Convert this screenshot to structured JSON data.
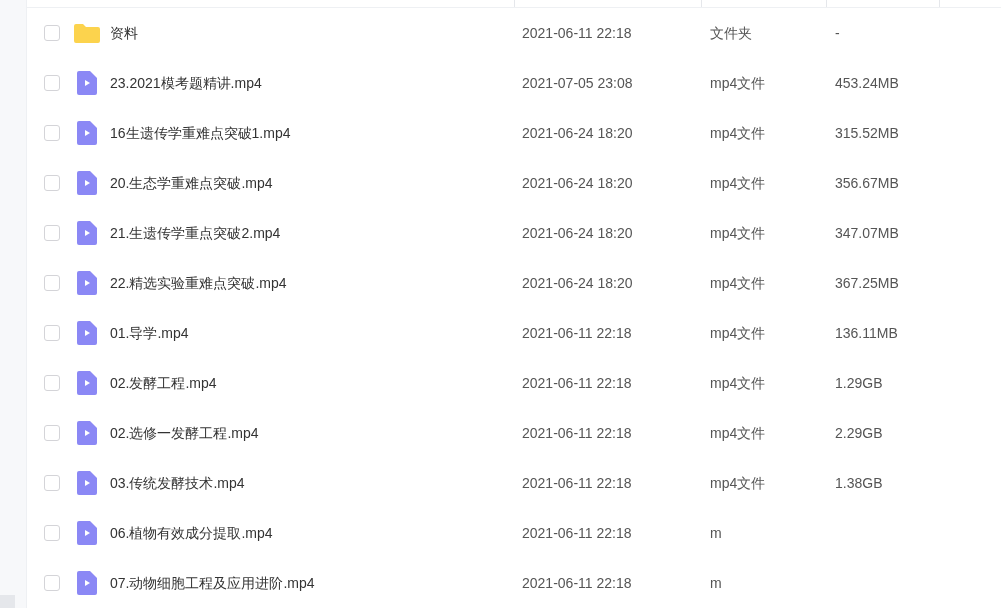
{
  "rows": [
    {
      "kind": "folder",
      "name": "资料",
      "date": "2021-06-11 22:18",
      "type": "文件夹",
      "size": "-",
      "checked": false
    },
    {
      "kind": "video",
      "name": "23.2021模考题精讲.mp4",
      "date": "2021-07-05 23:08",
      "type": "mp4文件",
      "size": "453.24MB",
      "checked": false
    },
    {
      "kind": "video",
      "name": "16生遗传学重难点突破1.mp4",
      "date": "2021-06-24 18:20",
      "type": "mp4文件",
      "size": "315.52MB",
      "checked": false
    },
    {
      "kind": "video",
      "name": "20.生态学重难点突破.mp4",
      "date": "2021-06-24 18:20",
      "type": "mp4文件",
      "size": "356.67MB",
      "checked": false
    },
    {
      "kind": "video",
      "name": "21.生遗传学重点突破2.mp4",
      "date": "2021-06-24 18:20",
      "type": "mp4文件",
      "size": "347.07MB",
      "checked": false
    },
    {
      "kind": "video",
      "name": "22.精选实验重难点突破.mp4",
      "date": "2021-06-24 18:20",
      "type": "mp4文件",
      "size": "367.25MB",
      "checked": false
    },
    {
      "kind": "video",
      "name": "01.导学.mp4",
      "date": "2021-06-11 22:18",
      "type": "mp4文件",
      "size": "136.11MB",
      "checked": false
    },
    {
      "kind": "video",
      "name": "02.发酵工程.mp4",
      "date": "2021-06-11 22:18",
      "type": "mp4文件",
      "size": "1.29GB",
      "checked": false
    },
    {
      "kind": "video",
      "name": "02.选修一发酵工程.mp4",
      "date": "2021-06-11 22:18",
      "type": "mp4文件",
      "size": "2.29GB",
      "checked": false
    },
    {
      "kind": "video",
      "name": "03.传统发酵技术.mp4",
      "date": "2021-06-11 22:18",
      "type": "mp4文件",
      "size": "1.38GB",
      "checked": false
    },
    {
      "kind": "video",
      "name": "06.植物有效成分提取.mp4",
      "date": "2021-06-11 22:18",
      "type": "m",
      "checked": false
    },
    {
      "kind": "video",
      "name": "07.动物细胞工程及应用进阶.mp4",
      "date": "2021-06-11 22:18",
      "type": "m",
      "checked": false
    }
  ]
}
